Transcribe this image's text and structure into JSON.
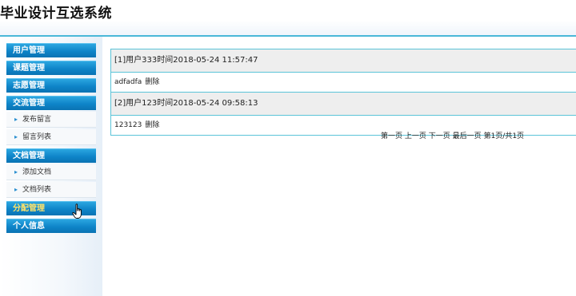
{
  "header": {
    "title": "毕业设计互选系统"
  },
  "sidebar": {
    "sections": [
      {
        "label": "用户管理",
        "items": []
      },
      {
        "label": "课题管理",
        "items": []
      },
      {
        "label": "志愿管理",
        "items": []
      },
      {
        "label": "交流管理",
        "items": [
          {
            "label": "发布留言"
          },
          {
            "label": "留言列表"
          }
        ]
      },
      {
        "label": "文档管理",
        "items": [
          {
            "label": "添加文档"
          },
          {
            "label": "文档列表"
          }
        ]
      },
      {
        "label": "分配管理",
        "items": [],
        "active": true
      },
      {
        "label": "个人信息",
        "items": []
      }
    ]
  },
  "messages": [
    {
      "header": "[1]用户333时间2018-05-24 11:57:47",
      "content": "adfadfa",
      "delete_label": "删除"
    },
    {
      "header": "[2]用户123时间2018-05-24 09:58:13",
      "content": "123123",
      "delete_label": "删除"
    }
  ],
  "pager": {
    "first": "第一页",
    "prev": "上一页",
    "next": "下一页",
    "last": "最后一页",
    "status": "第1页/共1页"
  },
  "colors": {
    "menu_header": "#0e84c8",
    "border": "#5bc4d8",
    "active_text": "#ffe36a"
  }
}
